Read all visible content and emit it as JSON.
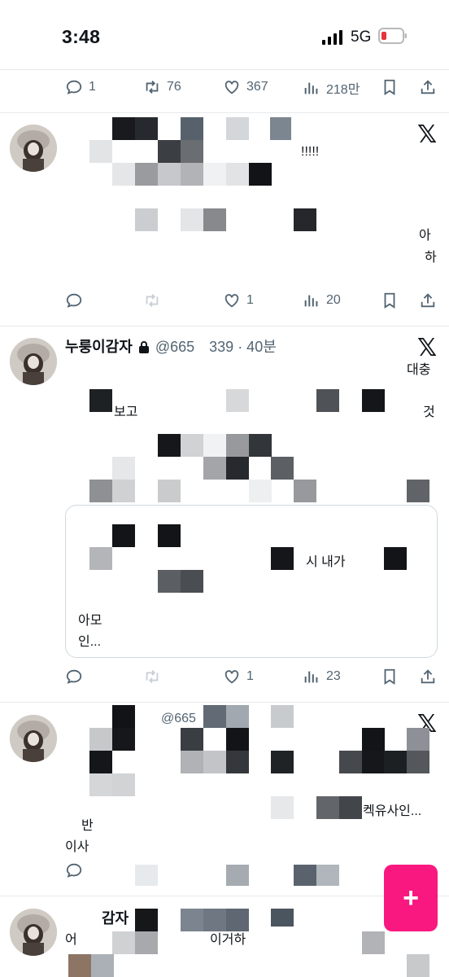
{
  "status_bar": {
    "time": "3:48",
    "network": "5G",
    "battery_color": "#e5343e"
  },
  "tweet_1_actions": {
    "replies": "1",
    "retweets": "76",
    "likes": "367",
    "views": "218만"
  },
  "tweet_2": {
    "text_fragments": [
      "!!!!!",
      "아",
      "하"
    ],
    "actions": {
      "replies": "",
      "retweets": "",
      "likes": "1",
      "views": "20"
    }
  },
  "tweet_3": {
    "name": "누룽이감자",
    "handle": "@665",
    "handle_tail": "339 · 40분",
    "text_fragments": [
      "대충",
      "보고",
      "것",
      "시 내가",
      "아모",
      "인..."
    ],
    "actions": {
      "replies": "",
      "retweets": "",
      "likes": "1",
      "views": "23"
    }
  },
  "tweet_4": {
    "handle_partial": "@665",
    "text_fragments": [
      "켁유사인...",
      "이사",
      "반"
    ]
  },
  "tweet_5": {
    "text_fragments": [
      "감자",
      "이거하",
      "어"
    ]
  },
  "fab": {
    "label": "+",
    "color": "#f91880"
  },
  "icons": [
    "reply-icon",
    "retweet-icon",
    "like-icon",
    "views-icon",
    "bookmark-icon",
    "share-icon",
    "lock-icon",
    "x-logo-icon"
  ],
  "colors": {
    "action_gray": "#536471",
    "divider": "#e6e9ec",
    "text": "#0f1419"
  }
}
